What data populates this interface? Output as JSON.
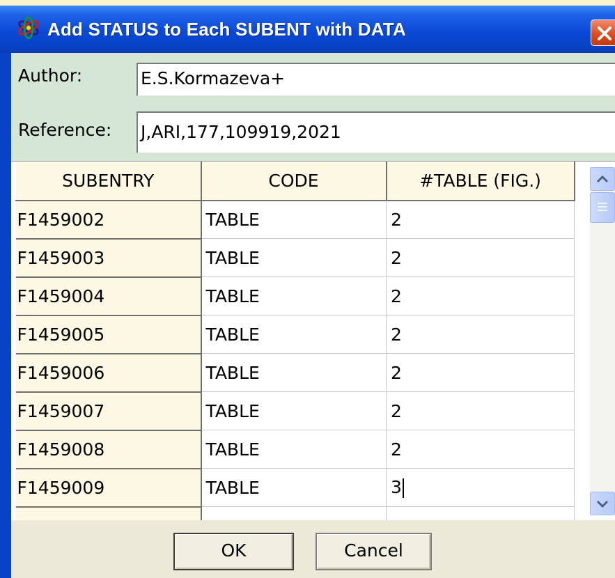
{
  "window": {
    "title": "Add STATUS to Each SUBENT with DATA"
  },
  "fields": {
    "author_label": "Author:",
    "author_value": "E.S.Kormazeva+",
    "reference_label": "Reference:",
    "reference_value": "J,ARI,177,109919,2021"
  },
  "grid": {
    "headers": [
      "SUBENTRY",
      "CODE",
      "#TABLE (FIG.)"
    ],
    "rows": [
      {
        "subentry": "F1459002",
        "code": "TABLE",
        "table": "2"
      },
      {
        "subentry": "F1459003",
        "code": "TABLE",
        "table": "2"
      },
      {
        "subentry": "F1459004",
        "code": "TABLE",
        "table": "2"
      },
      {
        "subentry": "F1459005",
        "code": "TABLE",
        "table": "2"
      },
      {
        "subentry": "F1459006",
        "code": "TABLE",
        "table": "2"
      },
      {
        "subentry": "F1459007",
        "code": "TABLE",
        "table": "2"
      },
      {
        "subentry": "F1459008",
        "code": "TABLE",
        "table": "2"
      },
      {
        "subentry": "F1459009",
        "code": "TABLE",
        "table": "3"
      }
    ]
  },
  "buttons": {
    "ok": "OK",
    "cancel": "Cancel"
  },
  "icons": {
    "app": "atom-icon",
    "close": "close-icon",
    "scroll_up": "chevron-up-icon",
    "scroll_down": "chevron-down-icon"
  },
  "colors": {
    "titlebar": "#0842c7",
    "info_panel": "#d6e6d6",
    "fixed_column": "#fcf8e3",
    "close_button": "#d9491f"
  }
}
